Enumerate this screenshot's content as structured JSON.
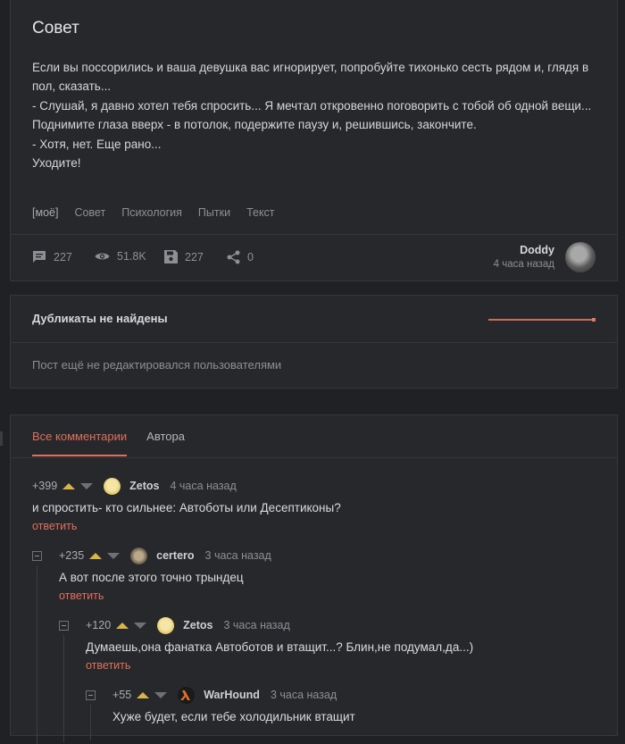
{
  "post": {
    "title": "Совет",
    "body": [
      "Если вы поссорились и ваша девушка вас игнорирует, попробуйте тихонько сесть рядом и, глядя в пол, сказать...",
      "- Слушай, я давно хотел тебя спросить... Я мечтал откровенно поговорить с тобой об одной вещи...",
      "Поднимите глаза вверх - в потолок, подержите паузу и, решившись, закончите.",
      "- Хотя, нет. Еще рано...",
      "Уходите!"
    ],
    "tags": [
      "[моё]",
      "Совет",
      "Психология",
      "Пытки",
      "Текст"
    ],
    "stats": {
      "comments": "227",
      "views": "51.8K",
      "saves": "227",
      "shares": "0"
    },
    "author": {
      "nick": "Doddy",
      "time": "4 часа назад"
    }
  },
  "duplicates": {
    "heading": "Дубликаты не найдены",
    "note": "Пост ещё не редактировался пользователями"
  },
  "comments_section": {
    "tabs": [
      "Все комментарии",
      "Автора"
    ],
    "reply_label": "ответить",
    "items": [
      {
        "rating": "+399",
        "nick": "Zetos",
        "time": "4 часа назад",
        "text": "и спростить- кто сильнее: Автоботы или Десептиконы?"
      },
      {
        "rating": "+235",
        "nick": "certero",
        "time": "3 часа назад",
        "text": "А вот после этого точно трындец"
      },
      {
        "rating": "+120",
        "nick": "Zetos",
        "time": "3 часа назад",
        "text": "Думаешь,она фанатка Автоботов и втащит...? Блин,не подумал,да...)"
      },
      {
        "rating": "+55",
        "nick": "WarHound",
        "time": "3 часа назад",
        "text": "Хуже будет, если тебе холодильник втащит"
      }
    ]
  },
  "colors": {
    "accent": "#e0705a",
    "upvote": "#d9b44a",
    "card": "#26282c",
    "bg": "#1f2124"
  }
}
